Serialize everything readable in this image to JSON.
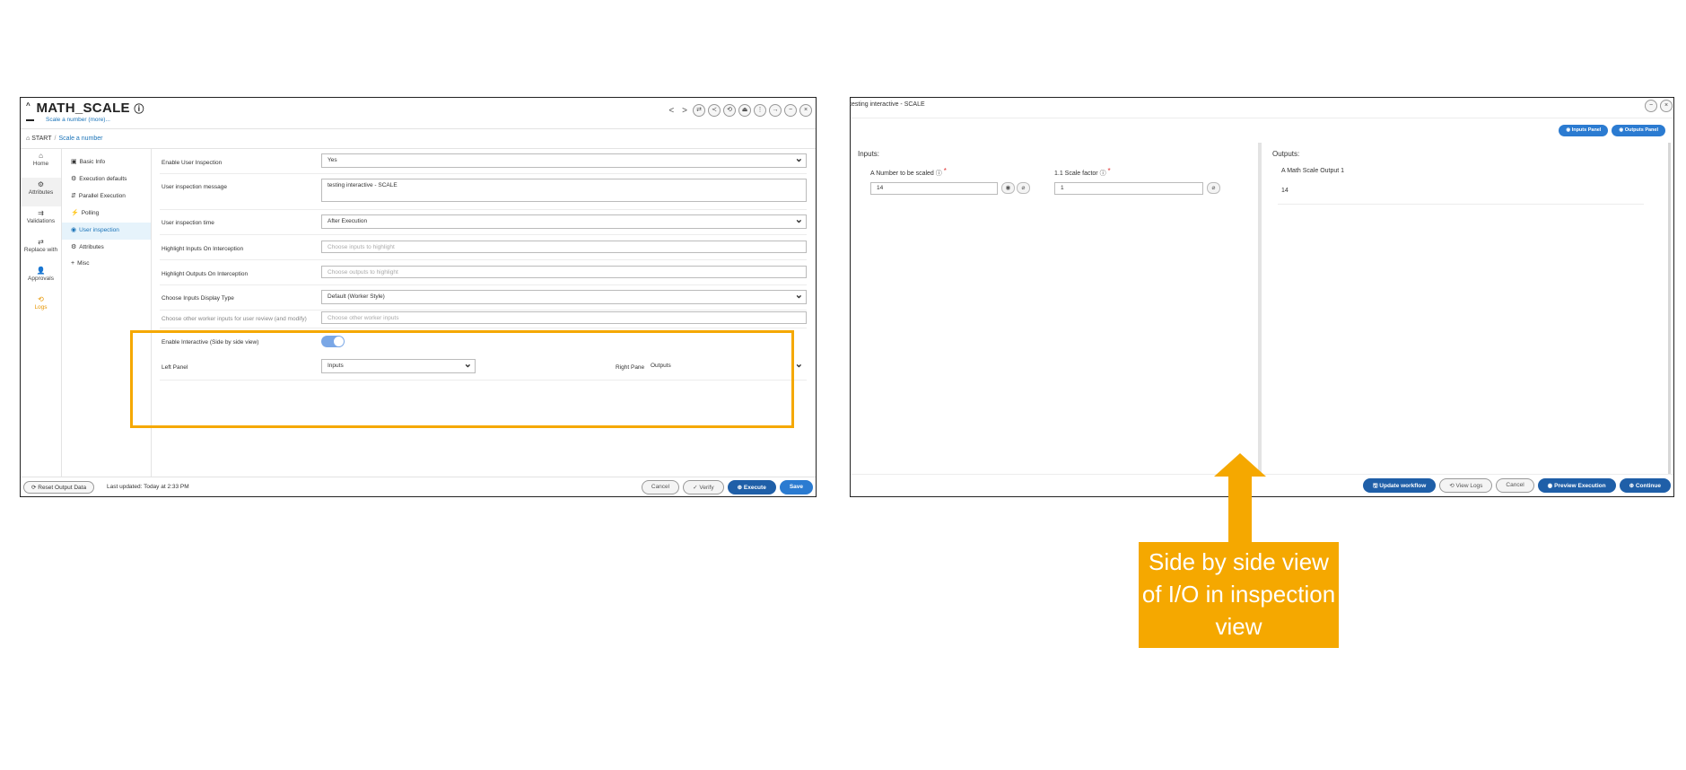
{
  "left_window": {
    "title": "MATH_SCALE",
    "title_caret": "^",
    "info_icon": "info-circle-icon",
    "subtitle": "Scale a number (more)...",
    "nav_prev": "<",
    "nav_next": ">",
    "toolbar_buttons": [
      "⇄",
      "≺",
      "⟲",
      "⏏",
      "⋮",
      "→",
      "−",
      "×"
    ],
    "breadcrumb": {
      "home": "START",
      "separator": "/",
      "current": "Scale a number"
    },
    "rail": [
      {
        "icon": "home-icon",
        "glyph": "⌂",
        "label": "Home"
      },
      {
        "icon": "gear-icon",
        "glyph": "⚙",
        "label": "Attributes"
      },
      {
        "icon": "validations-icon",
        "glyph": "⇉",
        "label": "Validations"
      },
      {
        "icon": "replace-icon",
        "glyph": "⇄",
        "label": "Replace with"
      },
      {
        "icon": "user-icon",
        "glyph": "👤",
        "label": "Approvals"
      },
      {
        "icon": "history-icon",
        "glyph": "⟲",
        "label": "Logs"
      }
    ],
    "nav_items": [
      {
        "icon": "info-icon",
        "glyph": "▣",
        "label": "Basic Info"
      },
      {
        "icon": "gear-icon",
        "glyph": "⚙",
        "label": "Execution defaults"
      },
      {
        "icon": "fork-icon",
        "glyph": "⇵",
        "label": "Parallel Execution"
      },
      {
        "icon": "bolt-icon",
        "glyph": "⚡",
        "label": "Polling"
      },
      {
        "icon": "eye-icon",
        "glyph": "◉",
        "label": "User inspection"
      },
      {
        "icon": "gear-icon",
        "glyph": "⚙",
        "label": "Attributes"
      },
      {
        "icon": "plus-icon",
        "glyph": "+",
        "label": "Misc"
      }
    ],
    "form": {
      "enable_user_inspection": {
        "label": "Enable User Inspection",
        "value": "Yes"
      },
      "inspection_message": {
        "label": "User inspection message",
        "value": "testing interactive - SCALE"
      },
      "inspection_time": {
        "label": "User inspection time",
        "value": "After Execution"
      },
      "highlight_inputs": {
        "label": "Highlight Inputs On Interception",
        "placeholder": "Choose inputs to highlight"
      },
      "highlight_outputs": {
        "label": "Highlight Outputs On Interception",
        "placeholder": "Choose outputs to highlight"
      },
      "inputs_display_type": {
        "label": "Choose Inputs Display Type",
        "value": "Default (Worker Style)"
      },
      "other_worker_inputs": {
        "label": "Choose other worker inputs for user review (and modify)",
        "placeholder": "Choose other worker inputs"
      },
      "enable_interactive": {
        "label": "Enable Interactive (Side by side view)",
        "enabled": true
      },
      "left_panel": {
        "label": "Left Panel",
        "value": "Inputs"
      },
      "right_panel": {
        "label": "Right Panel",
        "value": "Outputs"
      }
    },
    "footer": {
      "reset_label": "⟳ Reset Output Data",
      "last_updated": "Last updated: Today at 2:33 PM",
      "cancel": "Cancel",
      "verify": "✓ Verify",
      "execute": "⊕ Execute",
      "save": "Save"
    }
  },
  "right_window": {
    "title": "testing interactive - SCALE",
    "window_buttons": [
      "−",
      "×"
    ],
    "panel_buttons": {
      "inputs": "◉ Inputs Panel",
      "outputs": "◉ Outputs Panel"
    },
    "inputs": {
      "heading": "Inputs:",
      "field1": {
        "label": "A  Number to be scaled ⓘ",
        "required": "*",
        "value": "14"
      },
      "field2": {
        "label": "1.1  Scale factor ⓘ",
        "required": "*",
        "value": "1"
      }
    },
    "outputs": {
      "heading": "Outputs:",
      "field1": {
        "label": "A  Math Scale Output 1",
        "value": "14"
      }
    },
    "footer": {
      "update_workflow": "🖫 Update workflow",
      "view_logs": "⟲ View Logs",
      "cancel": "Cancel",
      "preview": "◉ Preview Execution",
      "continue": "⊕ Continue"
    }
  },
  "callout": {
    "text": "Side by side view of I/O in inspection view"
  },
  "colors": {
    "accent": "#f5a800",
    "primary": "#1f5fa8",
    "link": "#1a73b8"
  }
}
